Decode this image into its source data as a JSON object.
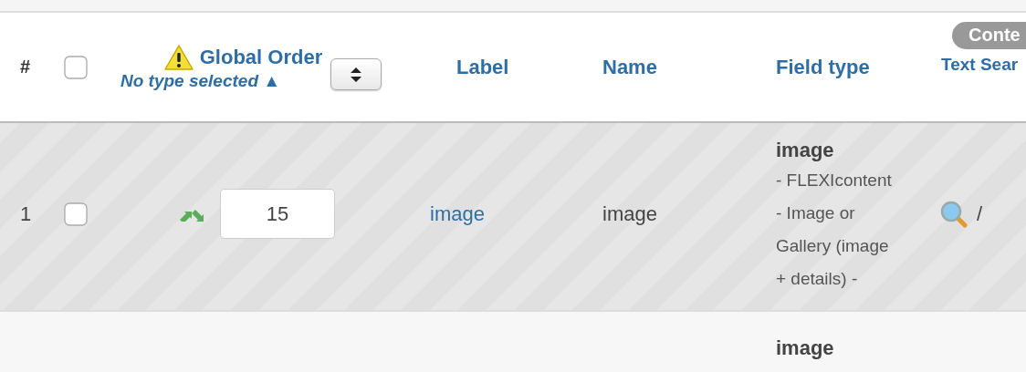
{
  "header": {
    "number": "#",
    "select_all": {
      "checked": false
    },
    "order_title": "Global Order",
    "order_filter": "No type selected",
    "order_sort": "▲",
    "label": "Label",
    "name": "Name",
    "field_type": "Field type",
    "content_badge": "Conte",
    "text_search": "Text Sear"
  },
  "rows": [
    {
      "striped": true,
      "number": "1",
      "checked": false,
      "order": "15",
      "label": "image",
      "name": "image",
      "type_name": "image",
      "type_lines": [
        "- FLEXIcontent",
        "- Image or",
        "Gallery (image",
        "+ details) -"
      ],
      "search_mark": "/"
    },
    {
      "striped": false,
      "type_name": "image",
      "type_lines": []
    }
  ]
}
